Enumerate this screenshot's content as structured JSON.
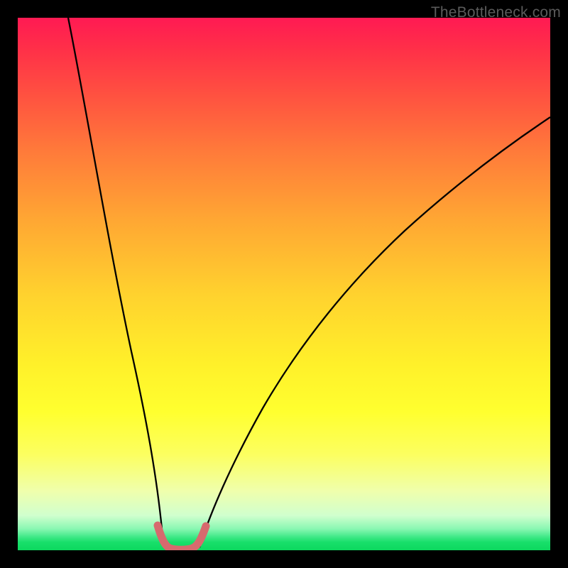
{
  "watermark": "TheBottleneck.com",
  "chart_data": {
    "type": "line",
    "title": "",
    "xlabel": "",
    "ylabel": "",
    "xlim": [
      0,
      100
    ],
    "ylim": [
      0,
      100
    ],
    "series": [
      {
        "name": "left-branch",
        "x": [
          9.5,
          12,
          15,
          18,
          21,
          23.5,
          25.5,
          27
        ],
        "values": [
          100,
          79,
          57,
          38,
          22,
          11,
          4,
          0
        ]
      },
      {
        "name": "valley-highlight",
        "x": [
          26,
          27,
          28.5,
          30.5,
          32.5,
          34,
          35
        ],
        "values": [
          3,
          0.5,
          0,
          0,
          0,
          0.5,
          3
        ]
      },
      {
        "name": "right-branch",
        "x": [
          34,
          36,
          40,
          46,
          54,
          63,
          73,
          83,
          92,
          100
        ],
        "values": [
          0,
          3,
          10,
          21,
          34,
          47,
          59,
          69,
          77,
          83
        ]
      }
    ],
    "highlight_series": "valley-highlight",
    "highlight_color": "#d66a6e",
    "curve_color": "#000000"
  }
}
